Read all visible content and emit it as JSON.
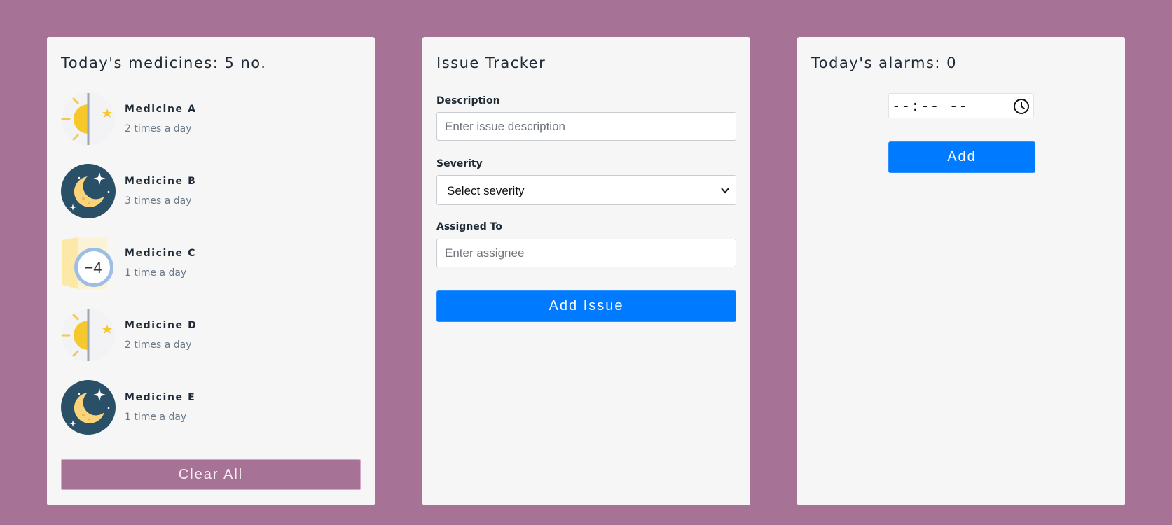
{
  "medicines": {
    "title": "Today's medicines: 5 no.",
    "items": [
      {
        "name": "Medicine A",
        "frequency": "2 times a day",
        "icon": "sun-moon-icon"
      },
      {
        "name": "Medicine B",
        "frequency": "3 times a day",
        "icon": "night-moon-icon"
      },
      {
        "name": "Medicine C",
        "frequency": "1 time a day",
        "icon": "minus-four-badge-icon",
        "badge_text": "−4"
      },
      {
        "name": "Medicine D",
        "frequency": "2 times a day",
        "icon": "sun-moon-icon"
      },
      {
        "name": "Medicine E",
        "frequency": "1 time a day",
        "icon": "night-moon-icon"
      }
    ],
    "clear_label": "Clear All"
  },
  "issues": {
    "title": "Issue Tracker",
    "description_label": "Description",
    "description_placeholder": "Enter issue description",
    "description_value": "",
    "severity_label": "Severity",
    "severity_selected": "Select severity",
    "assigned_label": "Assigned To",
    "assigned_placeholder": "Enter assignee",
    "assigned_value": "",
    "add_label": "Add Issue"
  },
  "alarms": {
    "title": "Today's alarms: 0",
    "time_value": "--:-- --",
    "add_label": "Add"
  },
  "colors": {
    "page_background": "#a67396",
    "card_background": "#f6f6f7",
    "primary": "#007bff",
    "clear_button": "#a67396"
  }
}
